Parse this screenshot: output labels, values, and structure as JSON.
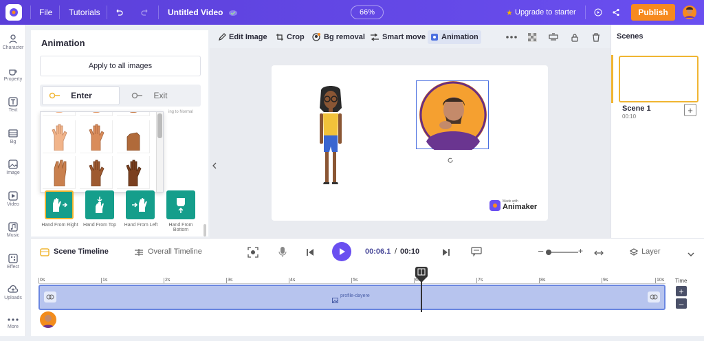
{
  "topbar": {
    "file": "File",
    "tutorials": "Tutorials",
    "title": "Untitled Video",
    "zoom": "66%",
    "upgrade": "Upgrade to starter",
    "publish": "Publish"
  },
  "leftbar": [
    {
      "icon": "character-icon",
      "label": "Character"
    },
    {
      "icon": "property-icon",
      "label": "Property"
    },
    {
      "icon": "text-icon",
      "label": "Text"
    },
    {
      "icon": "bg-icon",
      "label": "Bg"
    },
    {
      "icon": "image-icon",
      "label": "Image"
    },
    {
      "icon": "video-icon",
      "label": "Video"
    },
    {
      "icon": "music-icon",
      "label": "Music"
    },
    {
      "icon": "effect-icon",
      "label": "Effect"
    },
    {
      "icon": "uploads-icon",
      "label": "Uploads"
    },
    {
      "icon": "more-icon",
      "label": "More"
    }
  ],
  "panel": {
    "title": "Animation",
    "apply": "Apply to all images",
    "tab_enter": "Enter",
    "tab_exit": "Exit",
    "hint": "ing to Normal",
    "buttons": [
      "Hand From Right",
      "Hand From Top",
      "Hand From Left",
      "Hand From Bottom"
    ]
  },
  "toolbar": {
    "edit": "Edit Image",
    "crop": "Crop",
    "bg": "Bg removal",
    "smart": "Smart move",
    "animation": "Animation"
  },
  "canvas": {
    "made_with": "Made with",
    "brand": "Animaker"
  },
  "scenes": {
    "title": "Scenes",
    "scene_name": "Scene 1",
    "scene_time": "00:10"
  },
  "timeline": {
    "scene_tl": "Scene Timeline",
    "overall_tl": "Overall Timeline",
    "current": "00:06.1",
    "separator": "/",
    "total": "00:10",
    "layer": "Layer",
    "time": "Time",
    "track_label": "profile-dayere",
    "ticks": [
      "0s",
      "1s",
      "2s",
      "3s",
      "4s",
      "5s",
      "6s",
      "7s",
      "8s",
      "9s",
      "10s"
    ]
  },
  "colors": {
    "brand": "#6a4ff0",
    "accent": "#f78a1e",
    "teal": "#159e8b"
  }
}
